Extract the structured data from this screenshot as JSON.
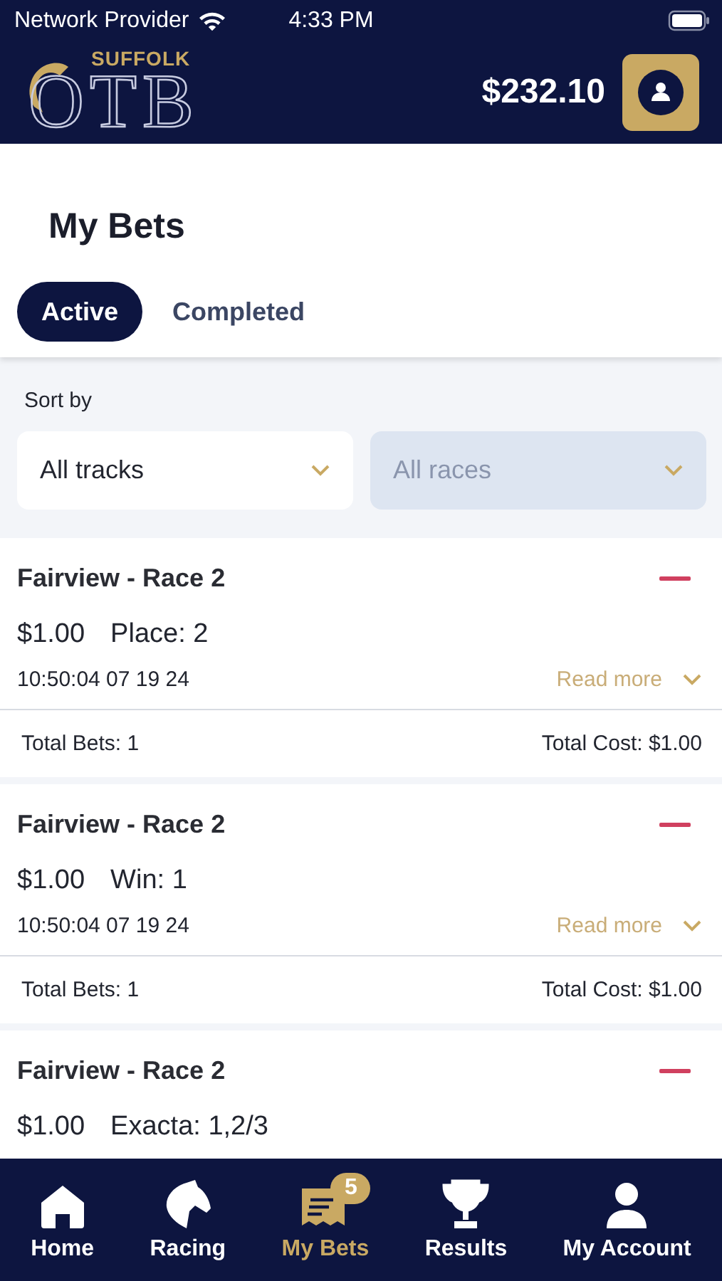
{
  "status_bar": {
    "carrier": "Network Provider",
    "time": "4:33 PM"
  },
  "header": {
    "logo": {
      "small": "SUFFOLK",
      "large": "OTB"
    },
    "balance": "$232.10"
  },
  "title": "My Bets",
  "tabs": [
    {
      "label": "Active",
      "selected": true
    },
    {
      "label": "Completed",
      "selected": false
    }
  ],
  "sort": {
    "label": "Sort by",
    "dropdowns": [
      {
        "value": "All tracks",
        "disabled": false
      },
      {
        "value": "All races",
        "disabled": true
      }
    ]
  },
  "bets": [
    {
      "race": "Fairview - Race 2",
      "amount": "$1.00",
      "bet": "Place: 2",
      "time": "10:50:04 07 19 24",
      "read_more": "Read more",
      "total_bets": "Total Bets: 1",
      "total_cost": "Total Cost: $1.00"
    },
    {
      "race": "Fairview - Race 2",
      "amount": "$1.00",
      "bet": "Win: 1",
      "time": "10:50:04 07 19 24",
      "read_more": "Read more",
      "total_bets": "Total Bets: 1",
      "total_cost": "Total Cost: $1.00"
    },
    {
      "race": "Fairview - Race 2",
      "amount": "$1.00",
      "bet": "Exacta: 1,2/3"
    }
  ],
  "nav": [
    {
      "kind": "home",
      "label": "Home",
      "selected": false
    },
    {
      "kind": "racing",
      "label": "Racing",
      "selected": false
    },
    {
      "kind": "bets",
      "label": "My Bets",
      "selected": true,
      "badge": "5"
    },
    {
      "kind": "results",
      "label": "Results",
      "selected": false
    },
    {
      "kind": "account",
      "label": "My Account",
      "selected": false
    }
  ]
}
